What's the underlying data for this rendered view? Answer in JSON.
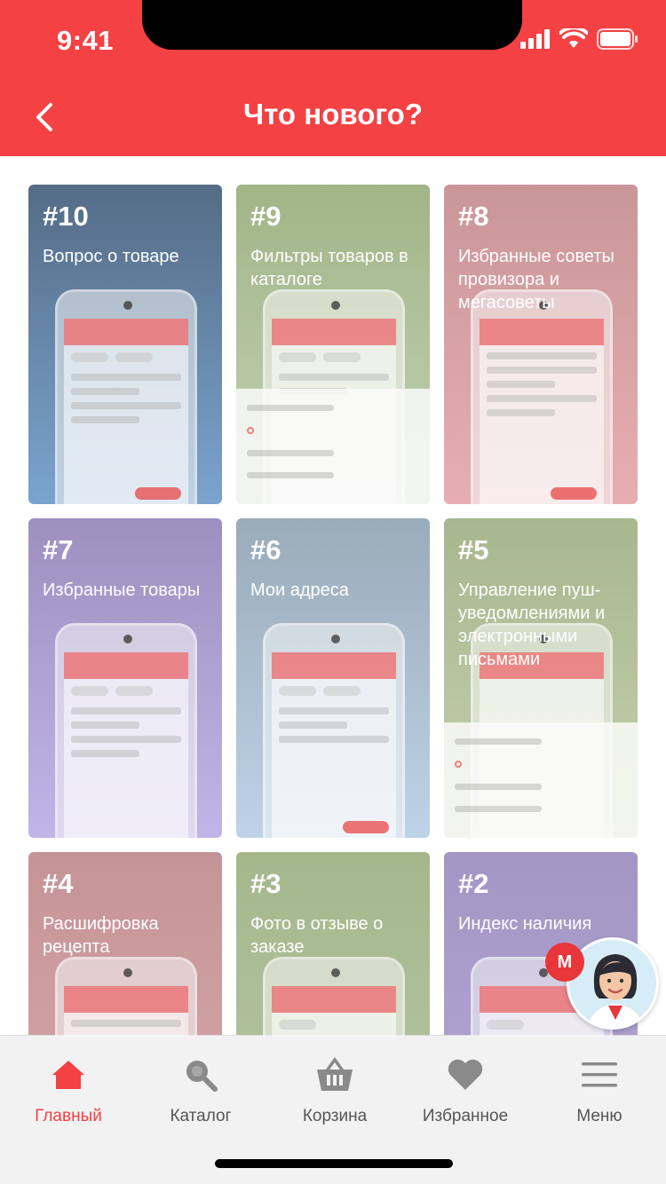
{
  "status_bar": {
    "time": "9:41"
  },
  "header": {
    "title": "Что нового?"
  },
  "cards": [
    {
      "number": "#10",
      "label": "Вопрос о товаре",
      "color": "#5f84a8"
    },
    {
      "number": "#9",
      "label": "Фильтры товаров в каталоге",
      "color": "#a9bd93"
    },
    {
      "number": "#8",
      "label": "Избранные советы провизора и мегасоветы",
      "color": "#d99ca0"
    },
    {
      "number": "#7",
      "label": "Избранные товары",
      "color": "#a99ccc"
    },
    {
      "number": "#6",
      "label": "Мои адреса",
      "color": "#9eb3c8"
    },
    {
      "number": "#5",
      "label": "Управление пуш-уведомлениями и электронными письмами",
      "color": "#aebd93"
    },
    {
      "number": "#4",
      "label": "Расшифровка рецепта",
      "color": "#c89a9e"
    },
    {
      "number": "#3",
      "label": "Фото в отзыве о заказе",
      "color": "#a9bd93"
    },
    {
      "number": "#2",
      "label": "Индекс наличия",
      "color": "#a99cc8"
    }
  ],
  "tabbar": {
    "items": [
      {
        "label": "Главный",
        "icon": "home-icon",
        "active": true
      },
      {
        "label": "Каталог",
        "icon": "search-icon",
        "active": false
      },
      {
        "label": "Корзина",
        "icon": "basket-icon",
        "active": false
      },
      {
        "label": "Избранное",
        "icon": "heart-icon",
        "active": false
      },
      {
        "label": "Меню",
        "icon": "menu-icon",
        "active": false
      }
    ]
  },
  "colors": {
    "brand": "#f44144",
    "tab_inactive": "#555555"
  }
}
